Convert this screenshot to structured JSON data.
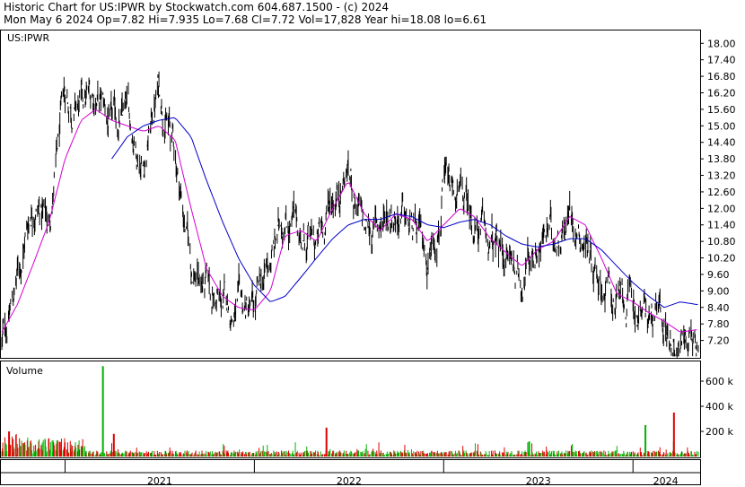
{
  "header": {
    "line1": "Historic Chart for US:IPWR by Stockwatch.com 604.687.1500 - (c) 2024",
    "line2": "Mon May  6 2024   Op=7.82  Hi=7.935  Lo=7.68  Cl=7.72  Vol=17,828  Year hi=18.08  lo=6.61"
  },
  "chart_data": {
    "type": "line",
    "symbol_label": "US:IPWR",
    "volume_label": "Volume",
    "price_axis": {
      "ticks": [
        "18.00",
        "17.40",
        "16.80",
        "16.20",
        "15.60",
        "15.00",
        "14.40",
        "13.80",
        "13.20",
        "12.60",
        "12.00",
        "11.40",
        "10.80",
        "10.20",
        "9.60",
        "9.00",
        "8.40",
        "7.80",
        "7.20"
      ],
      "ylim": [
        6.6,
        18.4
      ]
    },
    "volume_axis": {
      "ticks": [
        "600 k",
        "400 k",
        "200 k"
      ],
      "ylim": [
        0,
        750000
      ]
    },
    "x_axis": {
      "year_labels": [
        "2021",
        "2022",
        "2023",
        "2024"
      ],
      "range": [
        "2020-09",
        "2024-05"
      ]
    },
    "series": [
      {
        "name": "",
        "style": "price-bars",
        "color": "#000000",
        "x": [
          "2020-09-01",
          "2020-10-01",
          "2020-11-01",
          "2020-12-01",
          "2021-01-01",
          "2021-02-01",
          "2021-03-01",
          "2021-04-01",
          "2021-05-01",
          "2021-06-01",
          "2021-07-01",
          "2021-08-01",
          "2021-09-01",
          "2021-10-01",
          "2021-11-01",
          "2021-12-01",
          "2022-01-01",
          "2022-02-01",
          "2022-03-01",
          "2022-04-01",
          "2022-05-01",
          "2022-06-01",
          "2022-07-01",
          "2022-08-01",
          "2022-09-01",
          "2022-10-01",
          "2022-11-01",
          "2022-12-01",
          "2023-01-01",
          "2023-02-01",
          "2023-03-01",
          "2023-04-01",
          "2023-05-01",
          "2023-06-01",
          "2023-07-01",
          "2023-08-01",
          "2023-09-01",
          "2023-10-01",
          "2023-11-01",
          "2023-12-01",
          "2024-01-01",
          "2024-02-01",
          "2024-03-01",
          "2024-04-01",
          "2024-05-06"
        ],
        "y": [
          7.0,
          9.5,
          12.5,
          11.5,
          16.0,
          15.5,
          16.2,
          14.8,
          15.3,
          13.8,
          16.5,
          14.0,
          10.0,
          9.0,
          8.4,
          8.2,
          8.1,
          10.0,
          12.0,
          11.0,
          10.5,
          12.5,
          13.5,
          11.0,
          11.5,
          12.2,
          11.0,
          10.2,
          12.6,
          12.2,
          11.5,
          10.5,
          10.3,
          9.6,
          10.9,
          11.0,
          12.0,
          11.0,
          9.6,
          8.5,
          8.4,
          8.0,
          7.6,
          7.2,
          7.8
        ]
      },
      {
        "name": "",
        "style": "moving-average-short",
        "color": "#d400d4",
        "x": [
          "2020-09-01",
          "2020-10-01",
          "2020-11-01",
          "2020-12-01",
          "2021-01-01",
          "2021-02-01",
          "2021-03-01",
          "2021-04-01",
          "2021-05-01",
          "2021-06-01",
          "2021-07-01",
          "2021-08-01",
          "2021-09-01",
          "2021-10-01",
          "2021-11-01",
          "2021-12-01",
          "2022-01-01",
          "2022-02-01",
          "2022-03-01",
          "2022-04-01",
          "2022-05-01",
          "2022-06-01",
          "2022-07-01",
          "2022-08-01",
          "2022-09-01",
          "2022-10-01",
          "2022-11-01",
          "2022-12-01",
          "2023-01-01",
          "2023-02-01",
          "2023-03-01",
          "2023-04-01",
          "2023-05-01",
          "2023-06-01",
          "2023-07-01",
          "2023-08-01",
          "2023-09-01",
          "2023-10-01",
          "2023-11-01",
          "2023-12-01",
          "2024-01-01",
          "2024-02-01",
          "2024-03-01",
          "2024-04-01",
          "2024-05-06"
        ],
        "y": [
          7.5,
          8.5,
          10.0,
          11.5,
          13.8,
          15.2,
          15.6,
          15.2,
          15.0,
          14.8,
          15.0,
          14.5,
          12.0,
          9.8,
          8.8,
          8.4,
          8.3,
          9.0,
          11.0,
          11.2,
          10.8,
          12.0,
          13.0,
          11.8,
          11.2,
          11.8,
          11.6,
          10.8,
          11.4,
          12.0,
          11.7,
          10.9,
          10.4,
          9.9,
          10.5,
          10.8,
          11.7,
          11.4,
          10.2,
          8.9,
          8.6,
          8.2,
          7.9,
          7.5,
          7.6
        ]
      },
      {
        "name": "",
        "style": "moving-average-long",
        "color": "#0000c8",
        "x": [
          "2021-04-01",
          "2021-05-01",
          "2021-06-01",
          "2021-07-01",
          "2021-08-01",
          "2021-09-01",
          "2021-10-01",
          "2021-11-01",
          "2021-12-01",
          "2022-01-01",
          "2022-02-01",
          "2022-03-01",
          "2022-04-01",
          "2022-05-01",
          "2022-06-01",
          "2022-07-01",
          "2022-08-01",
          "2022-09-01",
          "2022-10-01",
          "2022-11-01",
          "2022-12-01",
          "2023-01-01",
          "2023-02-01",
          "2023-03-01",
          "2023-04-01",
          "2023-05-01",
          "2023-06-01",
          "2023-07-01",
          "2023-08-01",
          "2023-09-01",
          "2023-10-01",
          "2023-11-01",
          "2023-12-01",
          "2024-01-01",
          "2024-02-01",
          "2024-03-01",
          "2024-04-01",
          "2024-05-06"
        ],
        "y": [
          13.8,
          14.6,
          15.0,
          15.2,
          15.3,
          14.6,
          13.0,
          11.5,
          10.2,
          9.2,
          8.6,
          8.8,
          9.5,
          10.2,
          10.9,
          11.4,
          11.6,
          11.6,
          11.8,
          11.7,
          11.4,
          11.3,
          11.5,
          11.6,
          11.4,
          11.0,
          10.7,
          10.6,
          10.7,
          10.9,
          10.9,
          10.5,
          9.9,
          9.3,
          8.8,
          8.4,
          8.6,
          8.5
        ]
      }
    ],
    "volume": {
      "note_colors": {
        "up": "#00b400",
        "down": "#e00000"
      },
      "peaks": [
        {
          "date": "2020-09-15",
          "value": 200000,
          "color": "#e00000"
        },
        {
          "date": "2021-03-15",
          "value": 720000,
          "color": "#00b400"
        },
        {
          "date": "2021-04-05",
          "value": 180000,
          "color": "#e00000"
        },
        {
          "date": "2022-05-20",
          "value": 230000,
          "color": "#e00000"
        },
        {
          "date": "2023-06-15",
          "value": 120000,
          "color": "#00b400"
        },
        {
          "date": "2024-01-25",
          "value": 250000,
          "color": "#00b400"
        },
        {
          "date": "2024-03-20",
          "value": 350000,
          "color": "#e00000"
        }
      ]
    }
  }
}
